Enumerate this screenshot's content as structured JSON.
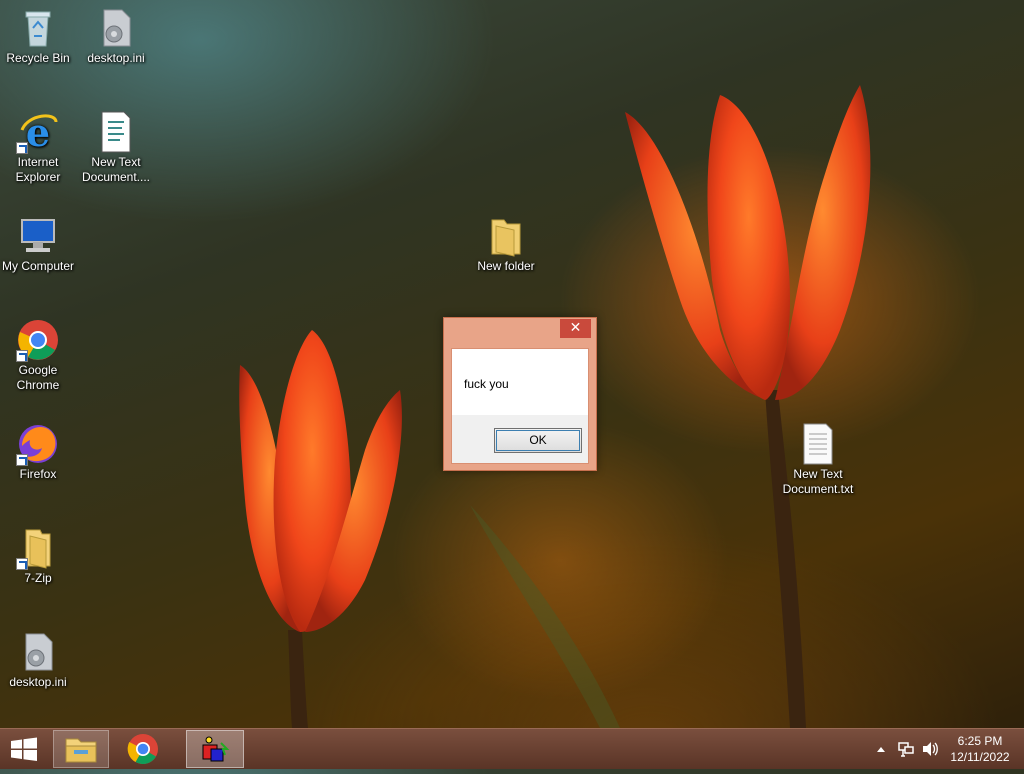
{
  "desktop": {
    "icons": [
      {
        "label": "Recycle Bin",
        "icon": "recycle-bin-icon"
      },
      {
        "label": "desktop.ini",
        "icon": "settings-file-icon"
      },
      {
        "label": "Internet Explorer",
        "icon": "internet-explorer-icon"
      },
      {
        "label": "New Text Document....",
        "icon": "text-document-icon"
      },
      {
        "label": "My Computer",
        "icon": "computer-icon"
      },
      {
        "label": "Google Chrome",
        "icon": "chrome-icon"
      },
      {
        "label": "Firefox",
        "icon": "firefox-icon"
      },
      {
        "label": "7-Zip",
        "icon": "folder-icon"
      },
      {
        "label": "desktop.ini",
        "icon": "settings-file-icon"
      },
      {
        "label": "New folder",
        "icon": "folder-icon"
      },
      {
        "label": "New Text Document.txt",
        "icon": "text-document-icon"
      }
    ]
  },
  "dialog": {
    "close_symbol": "✕",
    "message": "fuck you",
    "ok_label": "OK"
  },
  "taskbar": {
    "time": "6:25 PM",
    "date": "12/11/2022"
  },
  "colors": {
    "taskbar": "#6b4132",
    "dialog_frame": "#e8a488",
    "close_button": "#c94a3c"
  }
}
